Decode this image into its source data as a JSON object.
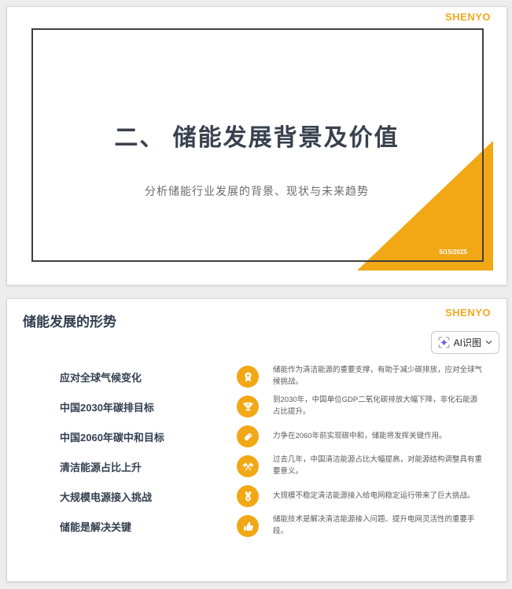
{
  "brand": {
    "logo_text": "SHENYO",
    "accent_orange": "#F2A715",
    "logo_orange": "#F5A81C",
    "ai_purple": "#7B52F2"
  },
  "slide1": {
    "title": "二、 储能发展背景及价值",
    "subtitle": "分析储能行业发展的背景、现状与未来趋势",
    "date": "5/15/2025",
    "logo": "SHENYO"
  },
  "slide2": {
    "title": "储能发展的形势",
    "logo": "SHENYO",
    "ai_button": {
      "label": "AI识图",
      "icon": "ai-scan-sparkle-icon",
      "chevron": "chevron-down-icon"
    },
    "rows": [
      {
        "label": "应对全球气候变化",
        "icon": "award-ribbon-icon",
        "desc": "储能作为清洁能源的重要支撑，有助于减少碳排放，应对全球气候挑战。"
      },
      {
        "label": "中国2030年碳排目标",
        "icon": "trophy-icon",
        "desc": "到2030年，中国单位GDP二氧化碳排放大幅下降，非化石能源占比提升。"
      },
      {
        "label": "中国2060年碳中和目标",
        "icon": "tag-icon",
        "desc": "力争在2060年前实现碳中和，储能将发挥关键作用。"
      },
      {
        "label": "清洁能源占比上升",
        "icon": "crossed-flags-icon",
        "desc": "过去几年，中国清洁能源占比大幅提高，对能源结构调整具有重要意义。"
      },
      {
        "label": "大规模电源接入挑战",
        "icon": "medal-star-icon",
        "desc": "大规模不稳定清洁能源接入给电网稳定运行带来了巨大挑战。"
      },
      {
        "label": "储能是解决关键",
        "icon": "thumbs-up-icon",
        "desc": "储能技术是解决清洁能源接入问题、提升电网灵活性的重要手段。"
      }
    ]
  }
}
